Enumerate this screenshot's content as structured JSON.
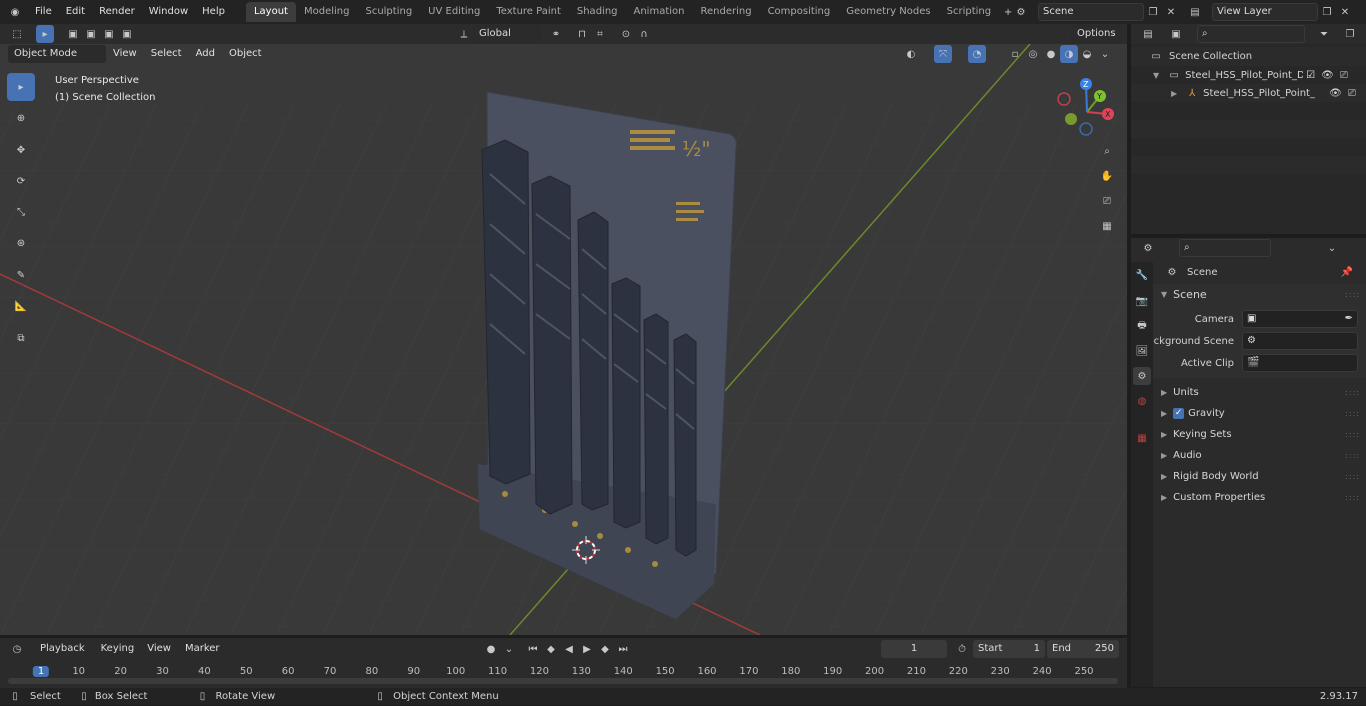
{
  "topbar": {
    "menus": [
      "File",
      "Edit",
      "Render",
      "Window",
      "Help"
    ],
    "workspaces": [
      "Layout",
      "Modeling",
      "Sculpting",
      "UV Editing",
      "Texture Paint",
      "Shading",
      "Animation",
      "Rendering",
      "Compositing",
      "Geometry Nodes",
      "Scripting"
    ],
    "active_workspace": "Layout",
    "scene_name": "Scene",
    "view_layer": "View Layer"
  },
  "viewport_header": {
    "mode": "Object Mode",
    "menus": [
      "View",
      "Select",
      "Add",
      "Object"
    ],
    "transform_orientation": "Global",
    "options_label": "Options"
  },
  "viewport": {
    "perspective_label": "User Perspective",
    "collection_label": "(1) Scene Collection",
    "gizmo_axes": [
      "X",
      "Y",
      "Z"
    ],
    "accent_color": "#4772b3"
  },
  "outliner": {
    "root": "Scene Collection",
    "items": [
      {
        "label": "Steel_HSS_Pilot_Point_Drill_Bi"
      },
      {
        "label": "Steel_HSS_Pilot_Point_Dr"
      }
    ]
  },
  "properties": {
    "breadcrumb": "Scene",
    "section": "Scene",
    "fields": [
      {
        "label": "Camera",
        "value": ""
      },
      {
        "label": "Background Scene",
        "value": ""
      },
      {
        "label": "Active Clip",
        "value": ""
      }
    ],
    "panels": [
      "Units",
      "Gravity",
      "Keying Sets",
      "Audio",
      "Rigid Body World",
      "Custom Properties"
    ],
    "gravity_checked": true
  },
  "timeline": {
    "menus": [
      "Playback",
      "Keying",
      "View",
      "Marker"
    ],
    "current_frame": "1",
    "start_label": "Start",
    "start_value": "1",
    "end_label": "End",
    "end_value": "250",
    "ticks": [
      "1",
      "10",
      "20",
      "30",
      "40",
      "50",
      "60",
      "70",
      "80",
      "90",
      "100",
      "110",
      "120",
      "130",
      "140",
      "150",
      "160",
      "170",
      "180",
      "190",
      "200",
      "210",
      "220",
      "230",
      "240",
      "250"
    ]
  },
  "statusbar": {
    "items": [
      "Select",
      "Box Select",
      "Rotate View",
      "Object Context Menu"
    ],
    "version": "2.93.17"
  }
}
